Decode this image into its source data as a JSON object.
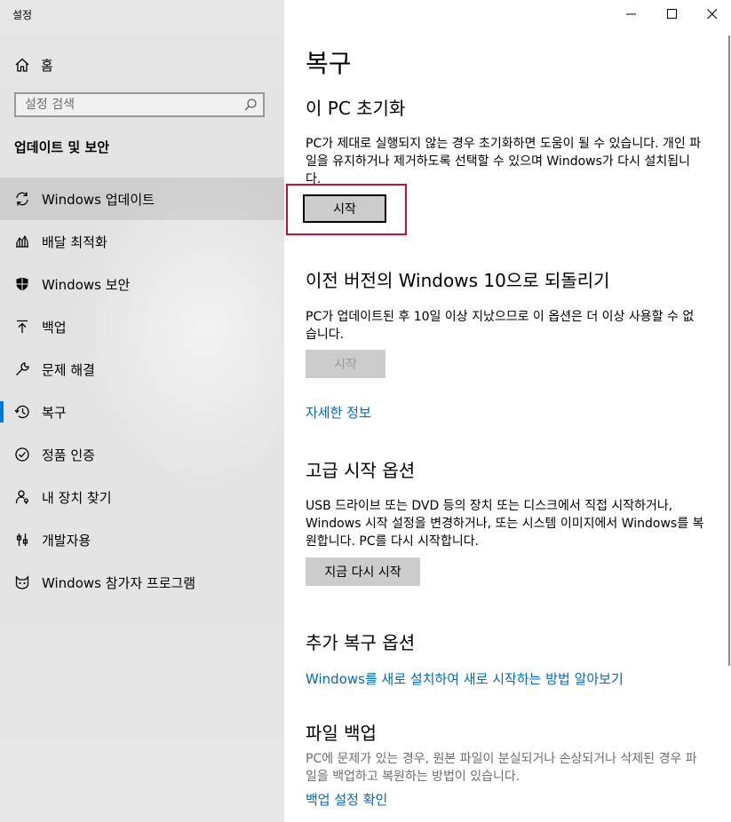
{
  "window": {
    "title": "설정"
  },
  "sidebar": {
    "home_label": "홈",
    "search_placeholder": "설정 검색",
    "section_title": "업데이트 및 보안",
    "items": [
      {
        "label": "Windows 업데이트",
        "icon": "sync-icon"
      },
      {
        "label": "배달 최적화",
        "icon": "delivery-icon"
      },
      {
        "label": "Windows 보안",
        "icon": "shield-icon"
      },
      {
        "label": "백업",
        "icon": "backup-arrow-icon"
      },
      {
        "label": "문제 해결",
        "icon": "wrench-icon"
      },
      {
        "label": "복구",
        "icon": "history-icon"
      },
      {
        "label": "정품 인증",
        "icon": "check-circle-icon"
      },
      {
        "label": "내 장치 찾기",
        "icon": "person-location-icon"
      },
      {
        "label": "개발자용",
        "icon": "developer-tools-icon"
      },
      {
        "label": "Windows 참가자 프로그램",
        "icon": "insider-cat-icon"
      }
    ],
    "active_item": "복구"
  },
  "main": {
    "page_title": "복구",
    "reset": {
      "heading": "이 PC 초기화",
      "description": "PC가 제대로 실행되지 않는 경우 초기화하면 도움이 될 수 있습니다. 개인 파일을 유지하거나 제거하도록 선택할 수 있으며 Windows가 다시 설치됩니다.",
      "button": "시작"
    },
    "rollback": {
      "heading": "이전 버전의 Windows 10으로 되돌리기",
      "description": "PC가 업데이트된 후 10일 이상 지났으므로 이 옵션은 더 이상 사용할 수 없습니다.",
      "button": "시작",
      "link": "자세한 정보"
    },
    "advanced": {
      "heading": "고급 시작 옵션",
      "description": "USB 드라이브 또는 DVD 등의 장치 또는 디스크에서 직접 시작하거나, Windows 시작 설정을 변경하거나, 또는 시스템 이미지에서 Windows를 복원합니다. PC를 다시 시작합니다.",
      "button": "지금 다시 시작"
    },
    "more": {
      "heading": "추가 복구 옵션",
      "link": "Windows를 새로 설치하여 새로 시작하는 방법 알아보기"
    },
    "file_backup": {
      "heading": "파일 백업",
      "description": "PC에 문제가 있는 경우, 원본 파일이 분실되거나 손상되거나 삭제된 경우 파일을 백업하고 복원하는 방법이 있습니다.",
      "link": "백업 설정 확인"
    }
  },
  "colors": {
    "accent": "#0078d7",
    "link": "#0067c0",
    "highlight_box": "#c8102e"
  }
}
